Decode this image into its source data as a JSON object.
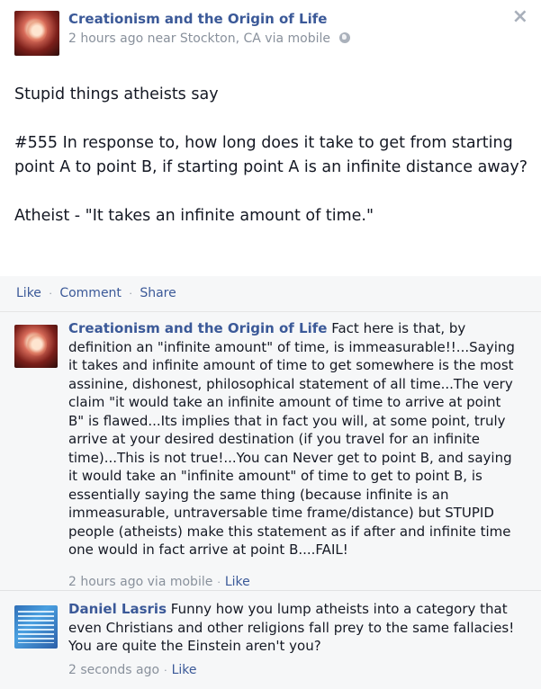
{
  "post": {
    "page_name": "Creationism and the Origin of Life",
    "meta": "2 hours ago near Stockton, CA via mobile",
    "close_glyph": "×",
    "paragraphs": [
      "Stupid things atheists say",
      "#555 In response to, how long does it take to get from starting point A to point B, if starting point A is an infinite distance away?",
      "Atheist - \"It takes an infinite amount of time.\""
    ]
  },
  "actions": {
    "like": "Like",
    "comment": "Comment",
    "share": "Share",
    "separator": "·"
  },
  "comments": [
    {
      "author": "Creationism and the Origin of Life",
      "text": "Fact here is that, by definition an \"infinite amount\" of time, is immeasurable!!...Saying it takes and infinite amount of time to get somewhere is the most assinine, dishonest, philosophical statement of all time...The very claim \"it would take an infinite amount of time to arrive at point B\" is flawed...Its implies that in fact you will, at some point, truly arrive at your desired destination (if you travel for an infinite time)...This is not true!...You can Never get to point B, and saying it would take an \"infinite amount\" of time to get to point B, is essentially saying the same thing (because infinite is an immeasurable, untraversable time frame/distance) but STUPID people (atheists) make this statement as if after and infinite time one would in fact arrive at point B....FAIL!",
      "time": "2 hours ago via mobile",
      "like": "Like",
      "separator": "·"
    },
    {
      "author": "Daniel Lasris",
      "text": "Funny how you lump atheists into a category that even Christians and other religions fall prey to the same fallacies! You are quite the Einstein aren't you?",
      "time": "2 seconds ago",
      "like": "Like",
      "separator": "·"
    }
  ],
  "colors": {
    "link": "#3b5998",
    "meta": "#89919c",
    "comment_bg": "#f6f7f8"
  },
  "icons": [
    "page-avatar-icon",
    "globe-icon",
    "close-icon",
    "user-avatar-icon"
  ]
}
